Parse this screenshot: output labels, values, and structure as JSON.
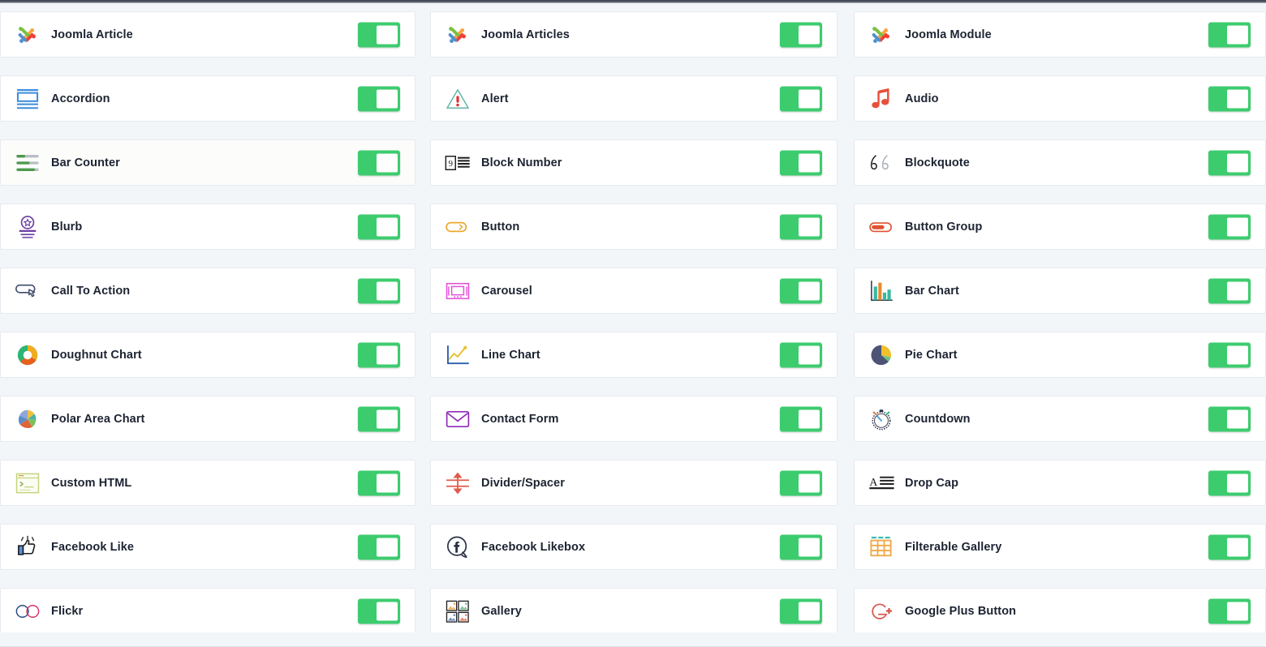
{
  "page": {
    "title": "Addon Manager",
    "toggle_state": "on",
    "accent_green": "#3ccc6e",
    "card_bg": "#ffffff",
    "page_bg": "#f3f6f9"
  },
  "columns": [
    {
      "items": [
        {
          "label": "Joomla Article",
          "icon": "joomla-icon",
          "enabled": true,
          "tint": false
        },
        {
          "label": "Accordion",
          "icon": "accordion-icon",
          "enabled": true,
          "tint": false
        },
        {
          "label": "Bar Counter",
          "icon": "bar-counter-icon",
          "enabled": true,
          "tint": true
        },
        {
          "label": "Blurb",
          "icon": "blurb-icon",
          "enabled": true,
          "tint": false
        },
        {
          "label": "Call To Action",
          "icon": "call-to-action-icon",
          "enabled": true,
          "tint": false
        },
        {
          "label": "Doughnut Chart",
          "icon": "doughnut-chart-icon",
          "enabled": true,
          "tint": false
        },
        {
          "label": "Polar Area Chart",
          "icon": "polar-area-chart-icon",
          "enabled": true,
          "tint": false
        },
        {
          "label": "Custom HTML",
          "icon": "custom-html-icon",
          "enabled": true,
          "tint": false
        },
        {
          "label": "Facebook Like",
          "icon": "facebook-like-icon",
          "enabled": true,
          "tint": false
        },
        {
          "label": "Flickr",
          "icon": "flickr-icon",
          "enabled": true,
          "tint": false
        }
      ]
    },
    {
      "items": [
        {
          "label": "Joomla Articles",
          "icon": "joomla-icon",
          "enabled": true,
          "tint": false
        },
        {
          "label": "Alert",
          "icon": "alert-icon",
          "enabled": true,
          "tint": false
        },
        {
          "label": "Block Number",
          "icon": "block-number-icon",
          "enabled": true,
          "tint": false
        },
        {
          "label": "Button",
          "icon": "button-icon",
          "enabled": true,
          "tint": false
        },
        {
          "label": "Carousel",
          "icon": "carousel-icon",
          "enabled": true,
          "tint": false
        },
        {
          "label": "Line Chart",
          "icon": "line-chart-icon",
          "enabled": true,
          "tint": false
        },
        {
          "label": "Contact Form",
          "icon": "contact-form-icon",
          "enabled": true,
          "tint": false
        },
        {
          "label": "Divider/Spacer",
          "icon": "divider-spacer-icon",
          "enabled": true,
          "tint": false
        },
        {
          "label": "Facebook Likebox",
          "icon": "facebook-likebox-icon",
          "enabled": true,
          "tint": false
        },
        {
          "label": "Gallery",
          "icon": "gallery-icon",
          "enabled": true,
          "tint": false
        }
      ]
    },
    {
      "items": [
        {
          "label": "Joomla Module",
          "icon": "joomla-icon",
          "enabled": true,
          "tint": false
        },
        {
          "label": "Audio",
          "icon": "audio-icon",
          "enabled": true,
          "tint": false
        },
        {
          "label": "Blockquote",
          "icon": "blockquote-icon",
          "enabled": true,
          "tint": false
        },
        {
          "label": "Button Group",
          "icon": "button-group-icon",
          "enabled": true,
          "tint": false
        },
        {
          "label": "Bar Chart",
          "icon": "bar-chart-icon",
          "enabled": true,
          "tint": false
        },
        {
          "label": "Pie Chart",
          "icon": "pie-chart-icon",
          "enabled": true,
          "tint": false
        },
        {
          "label": "Countdown",
          "icon": "countdown-icon",
          "enabled": true,
          "tint": false
        },
        {
          "label": "Drop Cap",
          "icon": "drop-cap-icon",
          "enabled": true,
          "tint": false
        },
        {
          "label": "Filterable Gallery",
          "icon": "filterable-gallery-icon",
          "enabled": true,
          "tint": false
        },
        {
          "label": "Google Plus Button",
          "icon": "google-plus-icon",
          "enabled": true,
          "tint": false
        }
      ]
    }
  ]
}
